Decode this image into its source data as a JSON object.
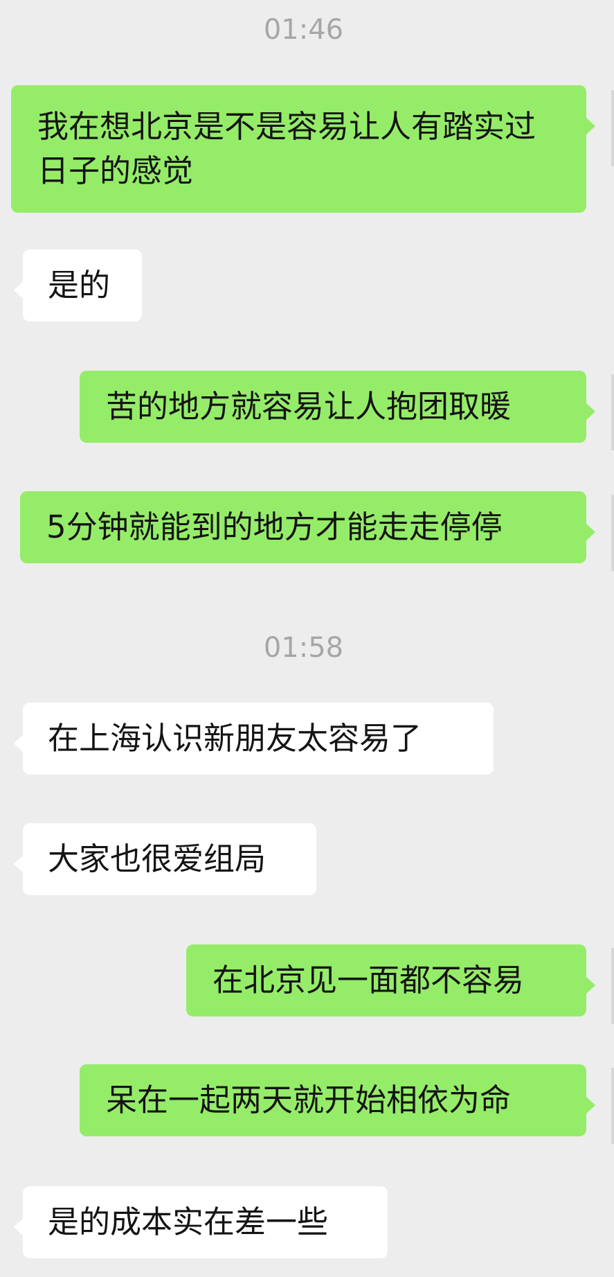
{
  "conversation": {
    "timestamps": [
      "01:46",
      "01:58"
    ],
    "messages": [
      {
        "side": "out",
        "text": "我在想北京是不是容易让人有踏实过日子的感觉"
      },
      {
        "side": "in",
        "text": "是的"
      },
      {
        "side": "out",
        "text": "苦的地方就容易让人抱团取暖"
      },
      {
        "side": "out",
        "text": "5分钟就能到的地方才能走走停停"
      },
      {
        "side": "in",
        "text": "在上海认识新朋友太容易了"
      },
      {
        "side": "in",
        "text": "大家也很爱组局"
      },
      {
        "side": "out",
        "text": "在北京见一面都不容易"
      },
      {
        "side": "out",
        "text": "呆在一起两天就开始相依为命"
      },
      {
        "side": "in",
        "text": "是的成本实在差一些"
      }
    ]
  },
  "colors": {
    "background": "#ededed",
    "outgoing_bubble": "#95ec69",
    "incoming_bubble": "#ffffff",
    "timestamp_text": "#a6a6a6"
  }
}
